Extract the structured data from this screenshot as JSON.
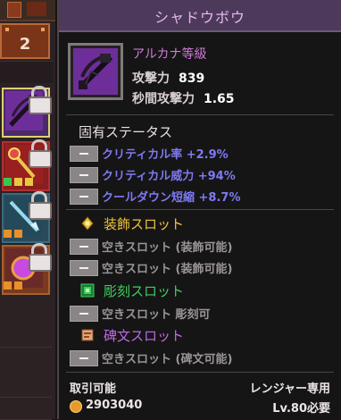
{
  "inventory": {
    "badge_count": "2"
  },
  "item": {
    "name": "シャドウボウ",
    "rarity": "アルカナ等級",
    "attack_label": "攻撃力",
    "attack_value": "839",
    "aps_label": "秒間攻撃力",
    "aps_value": "1.65"
  },
  "innate": {
    "header": "固有ステータス",
    "stats": [
      "クリティカル率 +2.9%",
      "クリティカル威力 +94%",
      "クールダウン短縮 +8.7%"
    ]
  },
  "decoration": {
    "header": "装飾スロット",
    "slots": [
      "空きスロット (装飾可能)",
      "空きスロット (装飾可能)"
    ]
  },
  "engraving": {
    "header": "彫刻スロット",
    "slots": [
      "空きスロット 彫刻可"
    ]
  },
  "rune": {
    "header": "碑文スロット",
    "slots": [
      "空きスロット (碑文可能)"
    ]
  },
  "footer": {
    "tradable": "取引可能",
    "class_req": "レンジャー専用",
    "price": "2903040",
    "level_req": "Lv.80必要"
  },
  "colors": {
    "rarity": "#cf7ad8",
    "affix": "#7d7af2",
    "decoration": "#f0c53a",
    "engraving": "#3ecf5a",
    "rune": "#c06ae8"
  }
}
